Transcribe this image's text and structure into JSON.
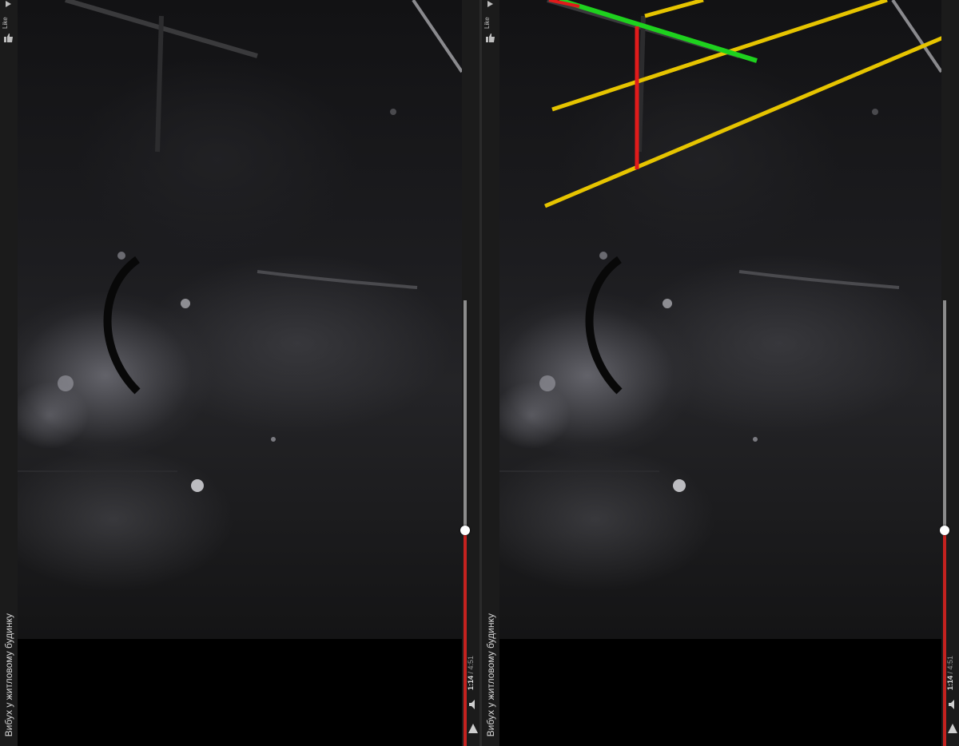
{
  "video": {
    "title": "Вибух у житловому будинку",
    "like_label": "Like",
    "time_current": "1:14",
    "time_separator": " / ",
    "time_total": "4:51",
    "progress_fraction": 0.4845
  },
  "annotations": {
    "yellow_color": "#e6c400",
    "green_color": "#1ed11e",
    "red_color": "#e01b1b"
  },
  "icons": {
    "like": "thumbs-up-icon",
    "volume": "volume-icon",
    "play": "play-icon"
  }
}
